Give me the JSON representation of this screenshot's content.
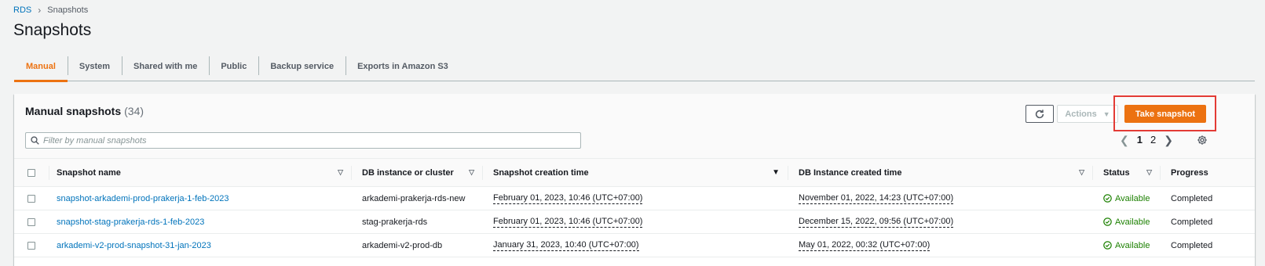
{
  "breadcrumb": {
    "root": "RDS",
    "current": "Snapshots"
  },
  "page_title": "Snapshots",
  "tabs": [
    {
      "label": "Manual",
      "active": true
    },
    {
      "label": "System"
    },
    {
      "label": "Shared with me"
    },
    {
      "label": "Public"
    },
    {
      "label": "Backup service"
    },
    {
      "label": "Exports in Amazon S3"
    }
  ],
  "panel": {
    "title": "Manual snapshots",
    "count": "(34)",
    "actions_label": "Actions",
    "take_snapshot_label": "Take snapshot",
    "search_placeholder": "Filter by manual snapshots",
    "pagination": {
      "pages": [
        "1",
        "2"
      ],
      "current": "1"
    }
  },
  "table": {
    "columns": [
      "Snapshot name",
      "DB instance or cluster",
      "Snapshot creation time",
      "DB Instance created time",
      "Status",
      "Progress"
    ],
    "rows": [
      {
        "name": "snapshot-arkademi-prod-prakerja-1-feb-2023",
        "instance": "arkademi-prakerja-rds-new",
        "snapshot_time": "February 01, 2023, 10:46 (UTC+07:00)",
        "instance_time": "November 01, 2022, 14:23 (UTC+07:00)",
        "status": "Available",
        "progress": "Completed"
      },
      {
        "name": "snapshot-stag-prakerja-rds-1-feb-2023",
        "instance": "stag-prakerja-rds",
        "snapshot_time": "February 01, 2023, 10:46 (UTC+07:00)",
        "instance_time": "December 15, 2022, 09:56 (UTC+07:00)",
        "status": "Available",
        "progress": "Completed"
      },
      {
        "name": "arkademi-v2-prod-snapshot-31-jan-2023",
        "instance": "arkademi-v2-prod-db",
        "snapshot_time": "January 31, 2023, 10:40 (UTC+07:00)",
        "instance_time": "May 01, 2022, 00:32 (UTC+07:00)",
        "status": "Available",
        "progress": "Completed"
      }
    ]
  },
  "colors": {
    "accent": "#ec7211",
    "link": "#0073bb",
    "success": "#1d8102",
    "highlight": "#e33b35"
  }
}
